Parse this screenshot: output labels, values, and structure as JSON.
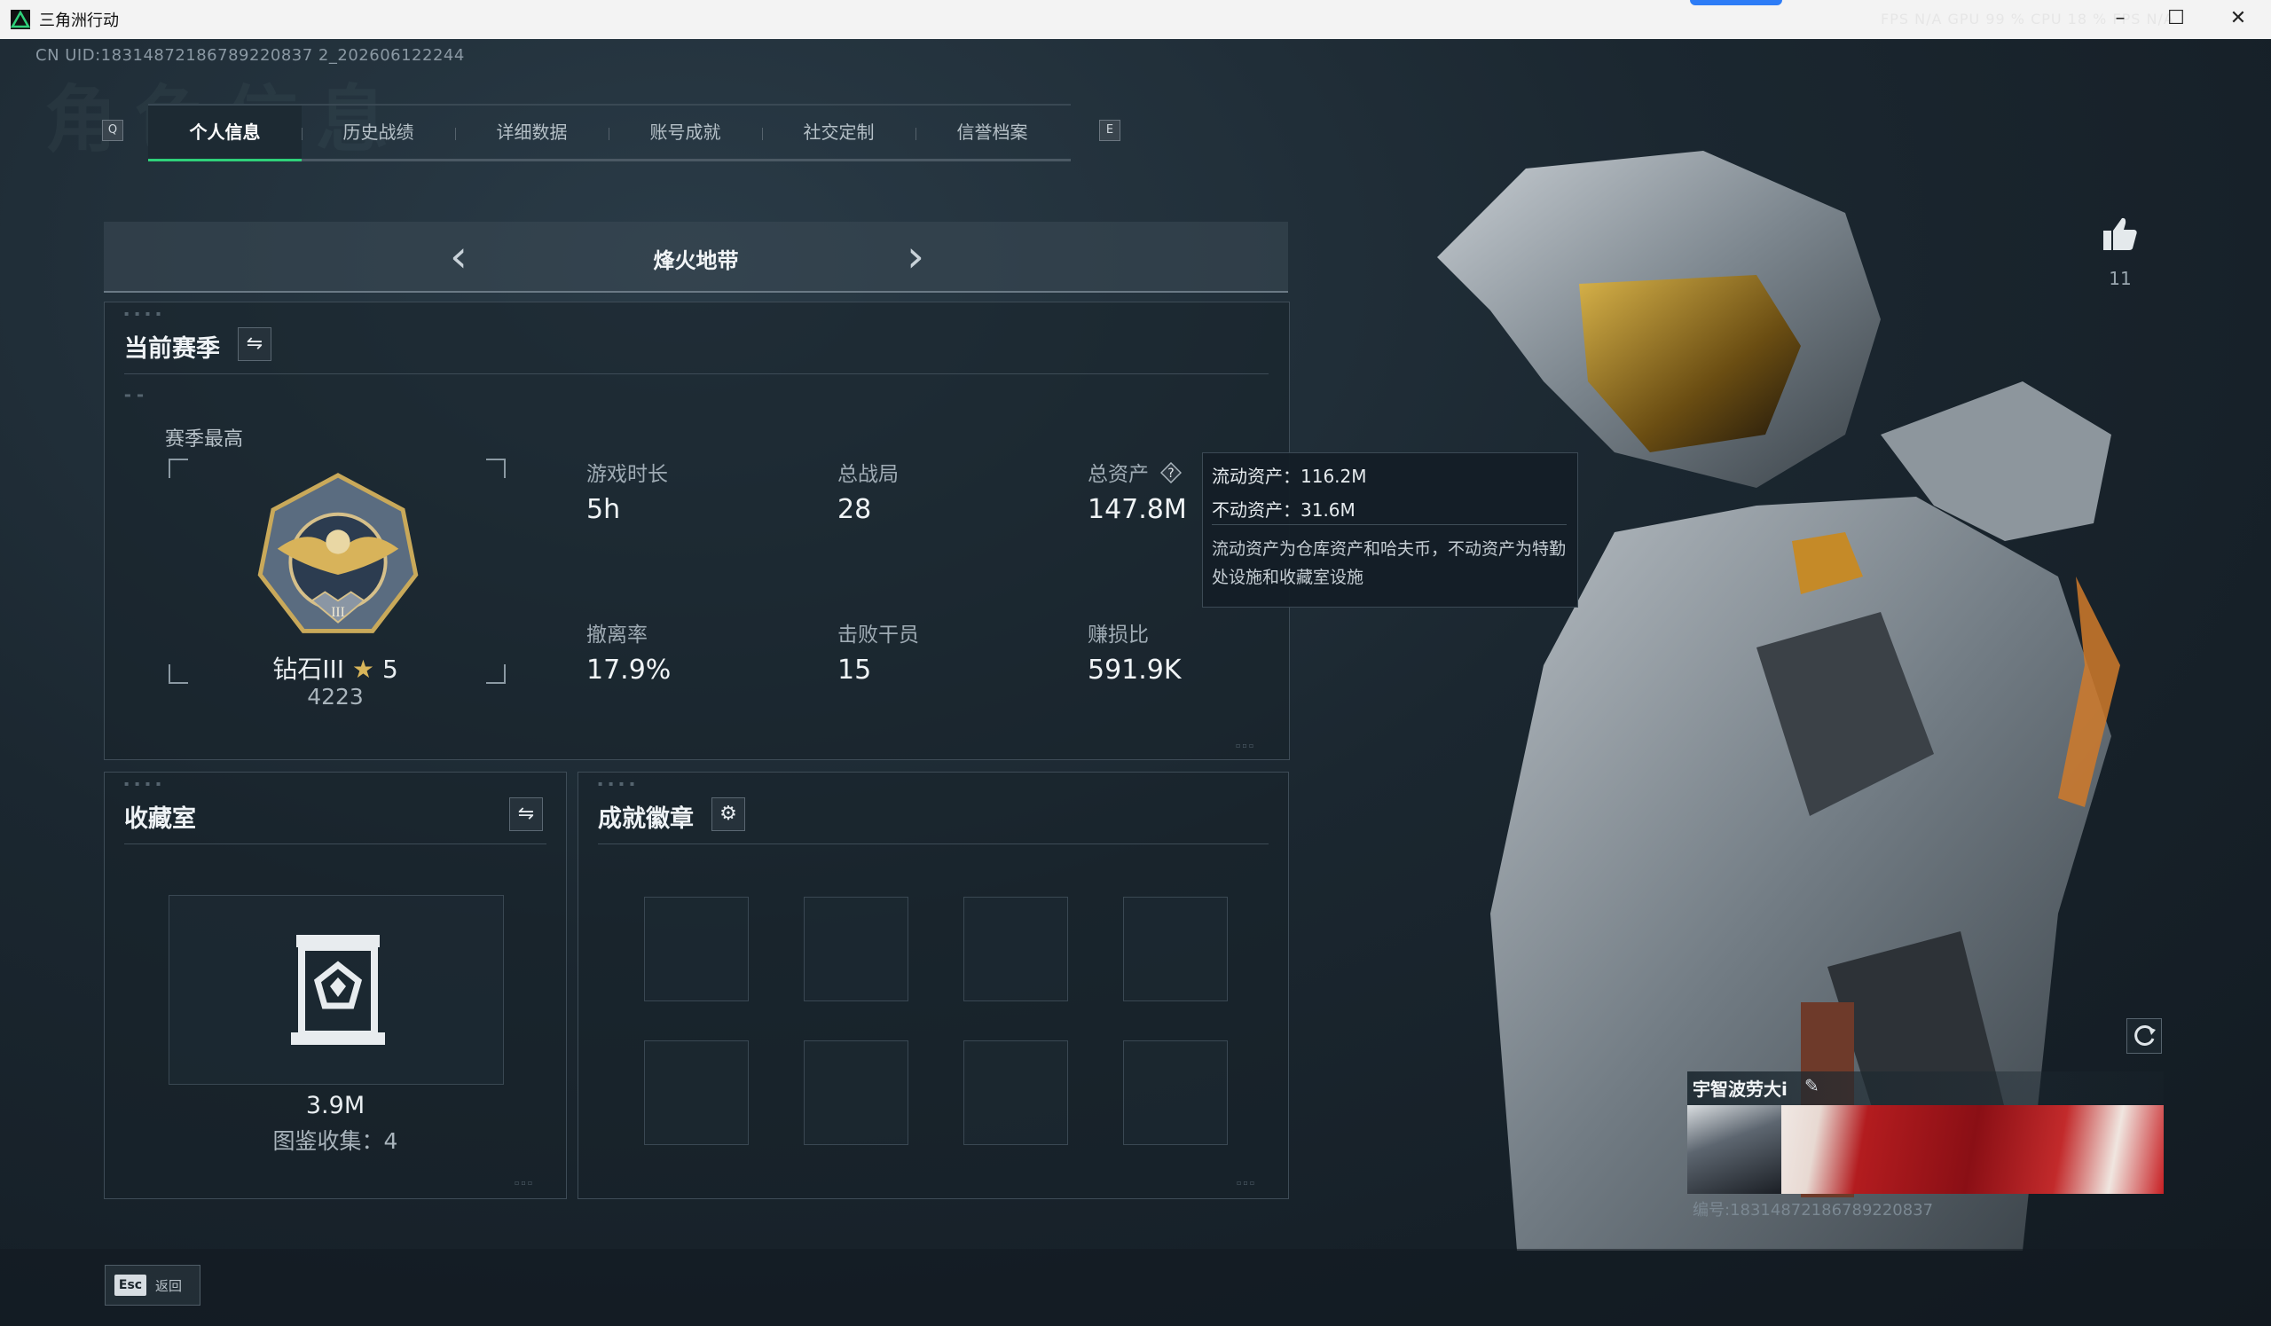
{
  "window": {
    "title": "三角洲行动",
    "perf_overlay": "FPS  N/A    GPU  99 %    CPU  18 %    FPS  N/A"
  },
  "uid": "CN UID:18314872186789220837 2_202606122244",
  "page_watermark": "角色信息",
  "tabs": {
    "prev_key": "Q",
    "next_key": "E",
    "items": [
      {
        "label": "个人信息",
        "active": true
      },
      {
        "label": "历史战绩",
        "active": false
      },
      {
        "label": "详细数据",
        "active": false
      },
      {
        "label": "账号成就",
        "active": false
      },
      {
        "label": "社交定制",
        "active": false
      },
      {
        "label": "信誉档案",
        "active": false
      }
    ]
  },
  "mode": {
    "name": "烽火地带"
  },
  "season": {
    "title": "当前赛季",
    "best_label": "赛季最高",
    "rank_name": "钻石III",
    "rank_stars": "5",
    "rank_score": "4223",
    "stats": [
      {
        "label": "游戏时长",
        "value": "5h"
      },
      {
        "label": "总战局",
        "value": "28"
      },
      {
        "label": "总资产",
        "value": "147.8M",
        "help": true
      },
      {
        "label": "撤离率",
        "value": "17.9%"
      },
      {
        "label": "击败干员",
        "value": "15"
      },
      {
        "label": "赚损比",
        "value": "591.9K"
      }
    ]
  },
  "asset_tooltip": {
    "liquid": "流动资产：116.2M",
    "fixed": "不动资产：31.6M",
    "note": "流动资产为仓库资产和哈夫币，不动资产为特勤处设施和收藏室设施"
  },
  "collection": {
    "title": "收藏室",
    "value": "3.9M",
    "catalog": "图鉴收集：4"
  },
  "achievements": {
    "title": "成就徽章",
    "slots": 8
  },
  "player": {
    "likes": "11",
    "name": "宇智波劳大i",
    "id_line": "编号:18314872186789220837"
  },
  "footer": {
    "esc_key": "Esc",
    "back_label": "返回"
  },
  "colors": {
    "accent_green": "#2fd17a",
    "star_gold": "#d9b65a",
    "banner_red": "#b31c1f"
  },
  "icons": [
    "app-icon",
    "chevron-left-icon",
    "chevron-right-icon",
    "swap-icon",
    "help-icon",
    "gear-icon",
    "thumbs-up-icon",
    "refresh-icon",
    "edit-icon",
    "showcase-icon",
    "rank-badge-icon"
  ]
}
